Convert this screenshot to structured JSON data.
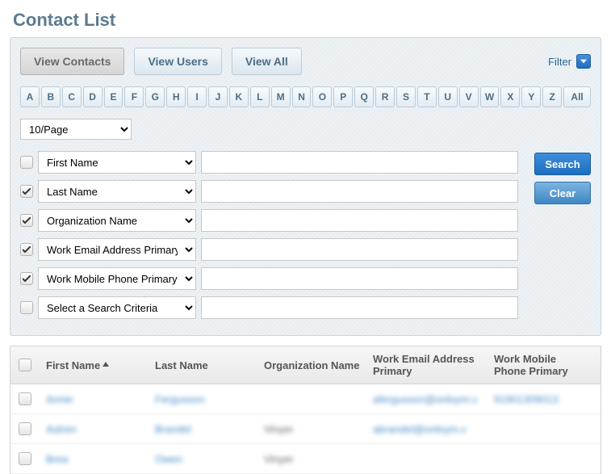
{
  "title": "Contact List",
  "tabs": [
    {
      "label": "View Contacts",
      "active": true
    },
    {
      "label": "View Users",
      "active": false
    },
    {
      "label": "View All",
      "active": false
    }
  ],
  "filter_label": "Filter",
  "alpha": [
    "A",
    "B",
    "C",
    "D",
    "E",
    "F",
    "G",
    "H",
    "I",
    "J",
    "K",
    "L",
    "M",
    "N",
    "O",
    "P",
    "Q",
    "R",
    "S",
    "T",
    "U",
    "V",
    "W",
    "X",
    "Y",
    "Z"
  ],
  "alpha_all": "All",
  "page_size": "10/Page",
  "criteria": [
    {
      "checked": false,
      "label": "First Name"
    },
    {
      "checked": true,
      "label": "Last Name"
    },
    {
      "checked": true,
      "label": "Organization Name"
    },
    {
      "checked": true,
      "label": "Work Email Address Primary"
    },
    {
      "checked": true,
      "label": "Work Mobile Phone Primary"
    },
    {
      "checked": false,
      "label": "Select a Search Criteria"
    }
  ],
  "buttons": {
    "search": "Search",
    "clear": "Clear"
  },
  "columns": {
    "first_name": "First Name",
    "last_name": "Last Name",
    "org": "Organization Name",
    "email": "Work Email Address Primary",
    "phone": "Work Mobile Phone Primary"
  },
  "rows": [
    {
      "fn": "Annie",
      "ln": "Fergusson",
      "org": "",
      "email": "afergusson@onloym.c",
      "phone": "91901309013"
    },
    {
      "fn": "Astren",
      "ln": "Brandel",
      "org": "Vinyer",
      "email": "abrandel@onloym.c",
      "phone": ""
    },
    {
      "fn": "Brea",
      "ln": "Owen",
      "org": "Vinyer",
      "email": "",
      "phone": ""
    }
  ]
}
